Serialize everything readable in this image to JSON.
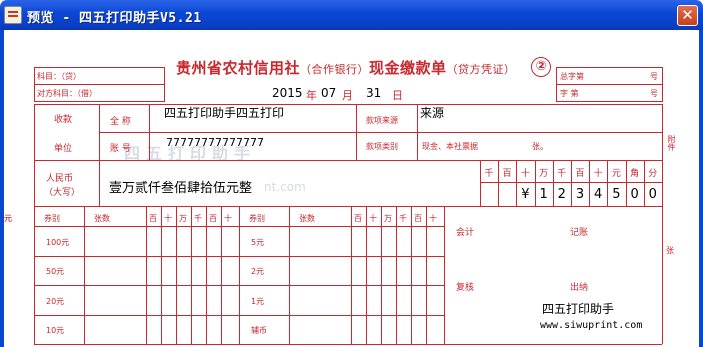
{
  "window": {
    "title": "预览 - 四五打印助手V5.21",
    "close_glyph": "✕"
  },
  "slip": {
    "title_main": "贵州省农村信用社",
    "title_paren": "（合作银行）",
    "title_doc": "现金缴款单",
    "title_sub": "（贷方凭证）",
    "copy_no": "②",
    "subject_label": "科目：（贷）",
    "counter_subject_label": "对方科目：（借）",
    "zongzihao_label": "总字第",
    "zihao_label": "字    第",
    "hao_label_1": "号",
    "hao_label_2": "号",
    "date": {
      "year": "2015",
      "year_unit": "年",
      "month": "07",
      "month_unit": "月",
      "day": "31",
      "day_unit": "日"
    },
    "payer_label_1": "收款",
    "payer_label_2": "单位",
    "fullname_label": "全   称",
    "account_label": "账   号",
    "fullname_value": "四五打印助手四五打印",
    "account_value": "77777777777777",
    "source_label": "款项来源",
    "source_value": "来源",
    "type_label": "款项类别",
    "type_options": "现金、本社票据",
    "type_suffix": "张。",
    "rmb_label_1": "人民币",
    "rmb_label_2": "（大写）",
    "amount_words": "壹万贰仟叁佰肆拾伍元整",
    "digit_headers": [
      "千",
      "百",
      "十",
      "万",
      "千",
      "百",
      "十",
      "元",
      "角",
      "分"
    ],
    "amount_digits": [
      "",
      "",
      "¥",
      "1",
      "2",
      "3",
      "4",
      "5",
      "0",
      "0"
    ],
    "attachment_label": "附件",
    "zhang_label": "张",
    "denom_header_left": [
      "券别",
      "张数",
      "百",
      "十",
      "万",
      "千",
      "百",
      "十",
      "元"
    ],
    "denom_header_right": [
      "券别",
      "张数",
      "百",
      "十",
      "万",
      "千",
      "百",
      "十",
      "元"
    ],
    "denoms_left": [
      "100元",
      "50元",
      "20元",
      "10元"
    ],
    "denoms_right": [
      "5元",
      "2元",
      "1元",
      "辅币"
    ],
    "accountant_label": "会计",
    "bookkeeper_label": "记账",
    "reviewer_label": "复核",
    "cashier_label": "出纳",
    "footer_brand": "四五打印助手",
    "footer_url": "www.siwuprint.com",
    "watermark_text": "四五打印助手",
    "watermark_url": "nt.com"
  },
  "colors": {
    "ink_red": "#c8282e",
    "titlebar_blue": "#0b47d4"
  }
}
